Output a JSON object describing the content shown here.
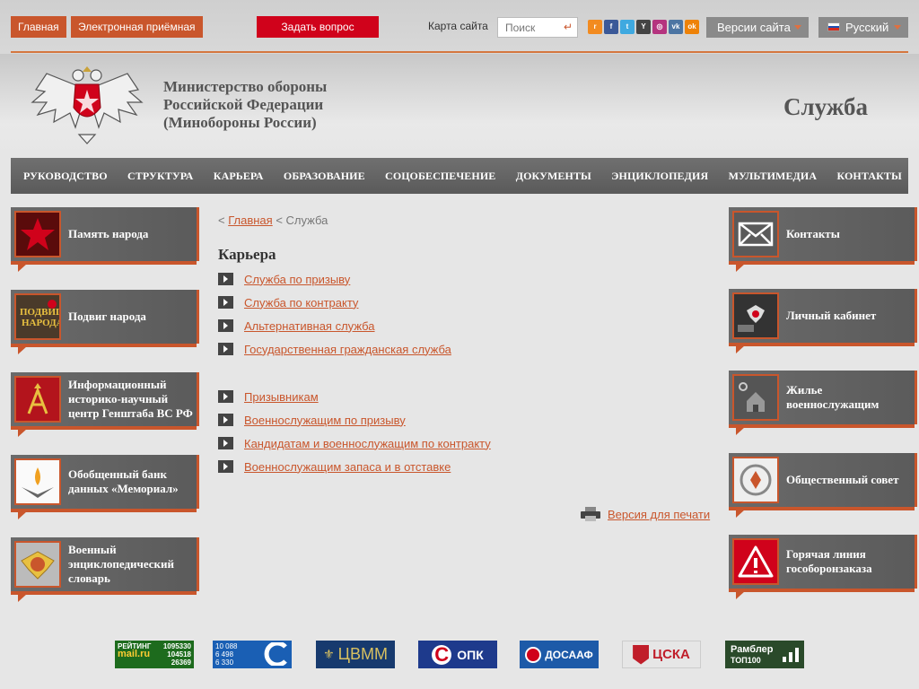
{
  "topbar": {
    "home": "Главная",
    "reception": "Электронная приёмная",
    "ask": "Задать вопрос",
    "sitemap": "Карта сайта",
    "search_placeholder": "Поиск",
    "versions": "Версии сайта",
    "language": "Русский",
    "social_icons": [
      "rss-icon",
      "facebook-icon",
      "twitter-icon",
      "youtube-icon",
      "instagram-icon",
      "vk-icon",
      "odnoklassniki-icon"
    ]
  },
  "header": {
    "ministry_line1": "Министерство обороны",
    "ministry_line2": "Российской Федерации",
    "ministry_line3": "(Минобороны России)",
    "page_title": "Служба"
  },
  "nav": [
    "РУКОВОДСТВО",
    "СТРУКТУРА",
    "КАРЬЕРА",
    "ОБРАЗОВАНИЕ",
    "СОЦОБЕСПЕЧЕНИЕ",
    "ДОКУМЕНТЫ",
    "ЭНЦИКЛОПЕДИЯ",
    "МУЛЬТИМЕДИА",
    "КОНТАКТЫ"
  ],
  "left_cards": [
    "Память народа",
    "Подвиг народа",
    "Информационный историко-научный центр Генштаба ВС РФ",
    "Обобщенный банк данных «Мемориал»",
    "Военный энциклопедический словарь"
  ],
  "right_cards": [
    "Контакты",
    "Личный кабинет",
    "Жилье военнослужащим",
    "Общественный совет",
    "Горячая линия гособоронзаказа"
  ],
  "breadcrumb": {
    "sep1": "<",
    "home": "Главная",
    "sep2": "<",
    "current": "Служба"
  },
  "section_title": "Карьера",
  "links_group1": [
    "Служба по призыву",
    "Служба по контракту",
    "Альтернативная служба",
    "Государственная гражданская служба"
  ],
  "links_group2": [
    "Призывникам",
    "Военнослужащим по призыву",
    "Кандидатам и военнослужащим по контракту",
    "Военнослужащим запаса и в отставке"
  ],
  "print_label": "Версия для печати",
  "banners": {
    "mailru_rating": "РЕЙТИНГ",
    "mailru_v1": "1095330",
    "mailru_v2": "104518",
    "mailru_v3": "26369",
    "mailru_logo": "mail.ru",
    "counter_v1": "10 088",
    "counter_v2": "6 498",
    "counter_v3": "6 330",
    "cvmm": "ЦВММ",
    "opk": "ОПК",
    "dosaaf": "ДОСААФ",
    "cska": "ЦСКА",
    "rambler_line1": "Рамблер",
    "rambler_line2": "ТОП100"
  },
  "colors": {
    "accent": "#c9562c",
    "ask_red": "#d0021b",
    "nav_bg": "#616161"
  }
}
